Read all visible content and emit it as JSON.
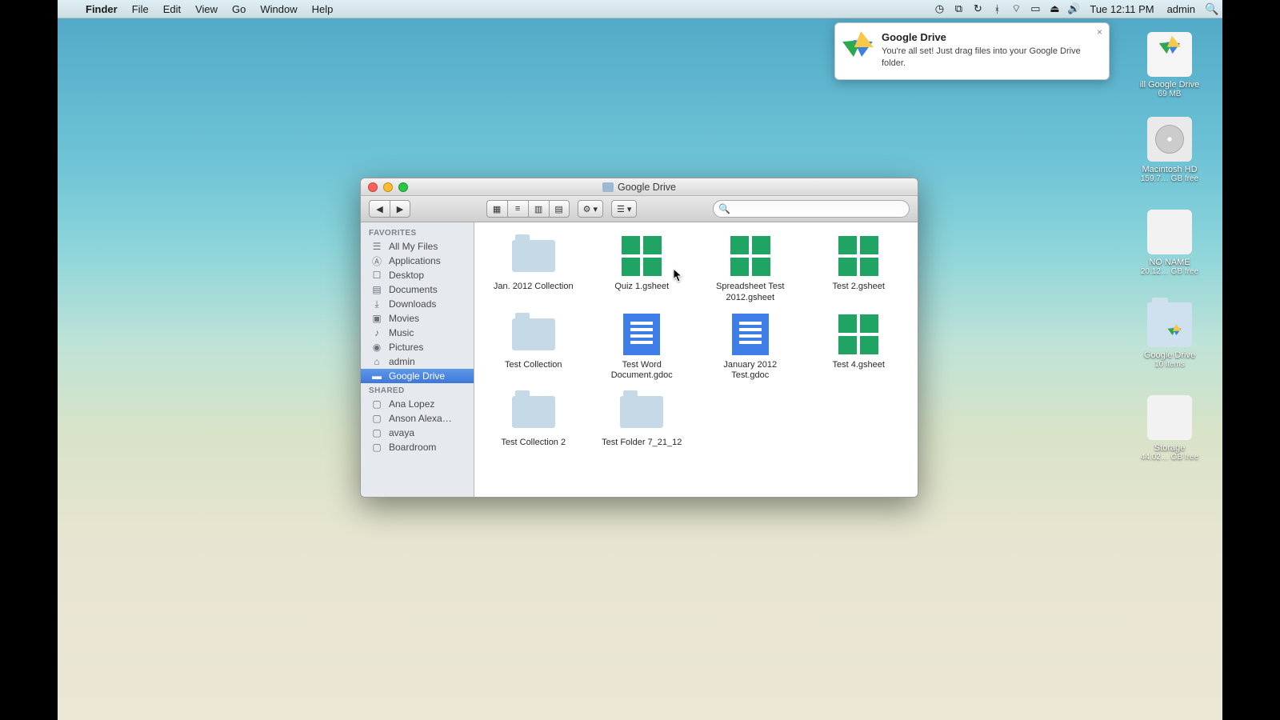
{
  "menubar": {
    "app": "Finder",
    "items": [
      "File",
      "Edit",
      "View",
      "Go",
      "Window",
      "Help"
    ],
    "clock": "Tue 12:11 PM",
    "user": "admin"
  },
  "notification": {
    "title": "Google Drive",
    "body": "You're all set! Just drag files into your Google Drive folder."
  },
  "desktop_icons": [
    {
      "name": "ill Google Drive",
      "sub": "69 MB",
      "kind": "gdrive-app"
    },
    {
      "name": "Macintosh HD",
      "sub": "159.7… GB free",
      "kind": "hd"
    },
    {
      "name": "NO NAME",
      "sub": "20.12… GB free",
      "kind": "ext"
    },
    {
      "name": "Google Drive",
      "sub": "10 items",
      "kind": "gdrive-folder"
    },
    {
      "name": "Storage",
      "sub": "44.02… GB free",
      "kind": "ext"
    }
  ],
  "finder": {
    "title": "Google Drive",
    "search_placeholder": "",
    "sidebar": {
      "favorites_label": "FAVORITES",
      "favorites": [
        {
          "label": "All My Files",
          "icon": "all-files"
        },
        {
          "label": "Applications",
          "icon": "apps"
        },
        {
          "label": "Desktop",
          "icon": "desktop"
        },
        {
          "label": "Documents",
          "icon": "docs"
        },
        {
          "label": "Downloads",
          "icon": "downloads"
        },
        {
          "label": "Movies",
          "icon": "movies"
        },
        {
          "label": "Music",
          "icon": "music"
        },
        {
          "label": "Pictures",
          "icon": "pictures"
        },
        {
          "label": "admin",
          "icon": "home"
        },
        {
          "label": "Google Drive",
          "icon": "folder",
          "selected": true
        }
      ],
      "shared_label": "SHARED",
      "shared": [
        {
          "label": "Ana Lopez"
        },
        {
          "label": "Anson Alexa…"
        },
        {
          "label": "avaya"
        },
        {
          "label": "Boardroom"
        }
      ]
    },
    "items": [
      {
        "label": "Jan. 2012 Collection",
        "type": "folder"
      },
      {
        "label": "Quiz 1.gsheet",
        "type": "gsheet"
      },
      {
        "label": "Spreadsheet Test 2012.gsheet",
        "type": "gsheet"
      },
      {
        "label": "Test 2.gsheet",
        "type": "gsheet"
      },
      {
        "label": "Test Collection",
        "type": "folder"
      },
      {
        "label": "Test Word Document.gdoc",
        "type": "gdoc"
      },
      {
        "label": "January 2012 Test.gdoc",
        "type": "gdoc"
      },
      {
        "label": "Test 4.gsheet",
        "type": "gsheet"
      },
      {
        "label": "Test Collection 2",
        "type": "folder"
      },
      {
        "label": "Test Folder 7_21_12",
        "type": "folder"
      }
    ]
  }
}
